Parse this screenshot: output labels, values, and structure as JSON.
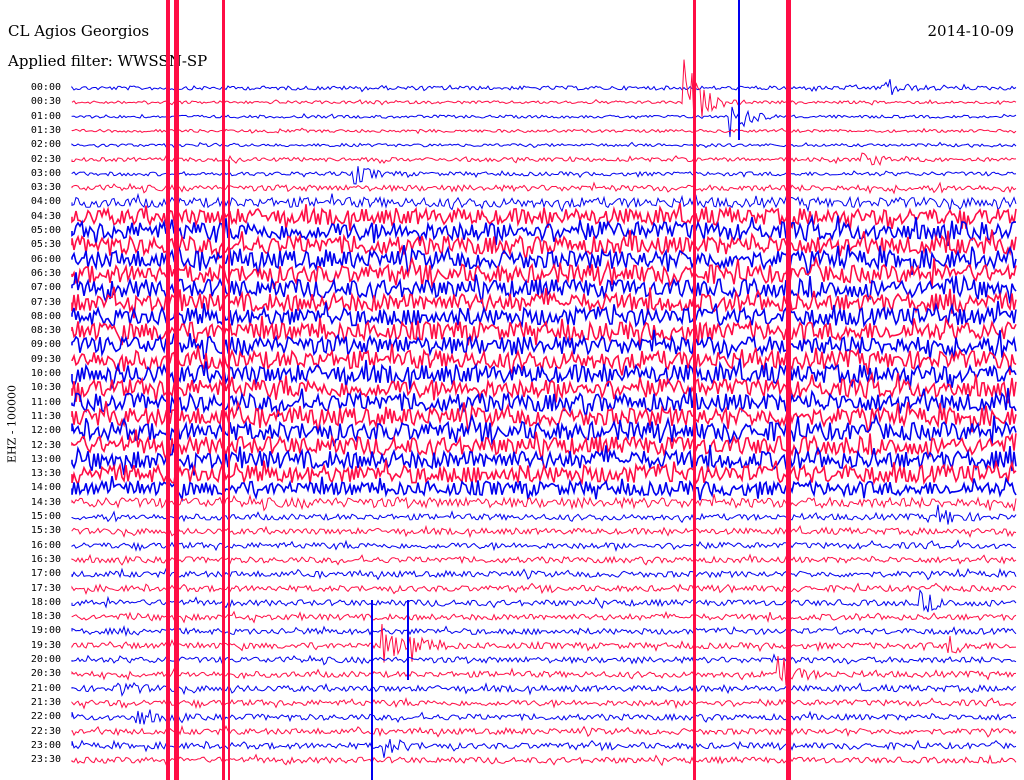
{
  "header": {
    "station": "CL Agios Georgios",
    "filter": "Applied filter: WWSSN-SP",
    "date": "2014-10-09"
  },
  "side_label": "EHZ - 100000",
  "colors": {
    "even_trace": "#0000ee",
    "odd_trace": "#ff0d45",
    "background": "#ffffff"
  },
  "chart_data": {
    "type": "line",
    "title": "CL Agios Georgios",
    "subtitle": "Applied filter: WWSSN-SP",
    "ylabel": "EHZ - 100000",
    "y_ticks": [
      "00:00",
      "00:30",
      "01:00",
      "01:30",
      "02:00",
      "02:30",
      "03:00",
      "03:30",
      "04:00",
      "04:30",
      "05:00",
      "05:30",
      "06:00",
      "06:30",
      "07:00",
      "07:30",
      "08:00",
      "08:30",
      "09:00",
      "09:30",
      "10:00",
      "10:30",
      "11:00",
      "11:30",
      "12:00",
      "12:30",
      "13:00",
      "13:30",
      "14:00",
      "14:30",
      "15:00",
      "15:30",
      "16:00",
      "16:30",
      "17:00",
      "17:30",
      "18:00",
      "18:30",
      "19:00",
      "19:30",
      "20:00",
      "20:30",
      "21:00",
      "21:30",
      "22:00",
      "22:30",
      "23:00",
      "23:30"
    ],
    "noise_level": [
      2,
      1.5,
      1.5,
      1.5,
      1.5,
      2,
      2,
      3,
      5,
      8,
      9,
      9,
      9,
      9,
      9,
      9,
      9,
      9,
      9,
      9,
      9,
      9,
      9,
      9,
      9,
      9,
      9,
      9,
      7,
      5,
      3,
      3,
      3,
      3,
      3,
      3,
      3,
      3,
      3,
      3,
      3,
      3,
      3,
      3,
      3,
      3,
      3,
      3
    ],
    "events": [
      {
        "time": "00:00",
        "x_frac": 0.86,
        "amp": 12
      },
      {
        "time": "00:30",
        "x_frac": 0.65,
        "amp": 45
      },
      {
        "time": "01:00",
        "x_frac": 0.7,
        "amp": 20
      },
      {
        "time": "02:30",
        "x_frac": 0.84,
        "amp": 6
      },
      {
        "time": "03:00",
        "x_frac": 0.3,
        "amp": 10
      },
      {
        "time": "15:00",
        "x_frac": 0.92,
        "amp": 10
      },
      {
        "time": "18:00",
        "x_frac": 0.9,
        "amp": 10
      },
      {
        "time": "19:30",
        "x_frac": 0.33,
        "amp": 18
      },
      {
        "time": "19:30",
        "x_frac": 0.36,
        "amp": 12
      },
      {
        "time": "19:30",
        "x_frac": 0.93,
        "amp": 8
      },
      {
        "time": "20:30",
        "x_frac": 0.75,
        "amp": 18
      },
      {
        "time": "21:00",
        "x_frac": 0.05,
        "amp": 8
      },
      {
        "time": "22:00",
        "x_frac": 0.07,
        "amp": 8
      },
      {
        "time": "23:00",
        "x_frac": 0.33,
        "amp": 10
      }
    ]
  }
}
